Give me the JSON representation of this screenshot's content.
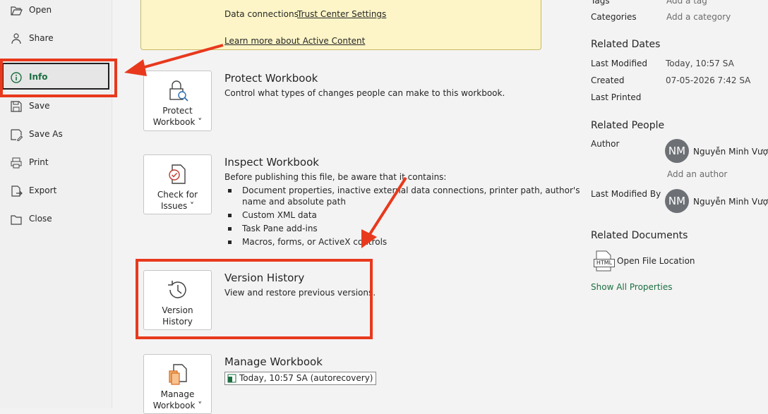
{
  "sidebar": {
    "items": [
      {
        "label": "Open",
        "icon": "folder-open-icon"
      },
      {
        "label": "Share",
        "icon": "share-icon"
      },
      {
        "label": "Info",
        "icon": "info-icon",
        "selected": true
      },
      {
        "label": "Save",
        "icon": "save-icon"
      },
      {
        "label": "Save As",
        "icon": "save-as-icon"
      },
      {
        "label": "Print",
        "icon": "print-icon"
      },
      {
        "label": "Export",
        "icon": "export-icon"
      },
      {
        "label": "Close",
        "icon": "close-folder-icon"
      }
    ]
  },
  "warning": {
    "data_connections_label": "Data connections",
    "trust_center_link": "Trust Center Settings",
    "learn_more_link": "Learn more about Active Content"
  },
  "sections": {
    "protect": {
      "button_line1": "Protect",
      "button_line2": "Workbook ˅",
      "title": "Protect Workbook",
      "desc": "Control what types of changes people can make to this workbook."
    },
    "inspect": {
      "button_line1": "Check for",
      "button_line2": "Issues ˅",
      "title": "Inspect Workbook",
      "desc": "Before publishing this file, be aware that it contains:",
      "bullets": [
        "Document properties, inactive external data connections, printer path, author's",
        "name and absolute path",
        "Custom XML data",
        "Task Pane add-ins",
        "Macros, forms, or ActiveX controls"
      ]
    },
    "version": {
      "button_line1": "Version",
      "button_line2": "History",
      "title": "Version History",
      "desc": "View and restore previous versions."
    },
    "manage": {
      "button_line1": "Manage",
      "button_line2": "Workbook ˅",
      "title": "Manage Workbook",
      "autorecovery": "Today, 10:57 SA (autorecovery)"
    }
  },
  "properties": {
    "tags_label": "Tags",
    "tags_value": "Add a tag",
    "categories_label": "Categories",
    "categories_value": "Add a category",
    "related_dates_heading": "Related Dates",
    "last_modified_label": "Last Modified",
    "last_modified_value": "Today, 10:57 SA",
    "created_label": "Created",
    "created_value": "07-05-2026 7:42 SA",
    "last_printed_label": "Last Printed",
    "related_people_heading": "Related People",
    "author_label": "Author",
    "author_initials": "NM",
    "author_name": "Nguyễn Minh Vượng",
    "add_author": "Add an author",
    "last_modified_by_label": "Last Modified By",
    "last_modified_by_initials": "NM",
    "last_modified_by_name": "Nguyễn Minh Vượng",
    "related_docs_heading": "Related Documents",
    "open_file_location": "Open File Location",
    "html_icon_text": "HTML",
    "show_all": "Show All Properties"
  },
  "colors": {
    "highlight_red": "#e8391d",
    "accent_green": "#1d6f42",
    "warning_bg": "#fdf5c7"
  }
}
